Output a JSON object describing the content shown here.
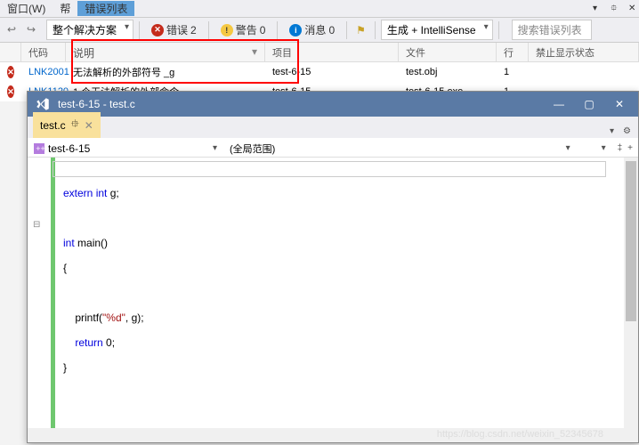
{
  "menu": {
    "window": "窗口(W)",
    "help": "帮"
  },
  "error_list_tab": "错误列表",
  "toolbar": {
    "scope": "整个解决方案",
    "errors_label": "错误",
    "errors_count": "2",
    "warnings_label": "警告",
    "warnings_count": "0",
    "messages_label": "消息",
    "messages_count": "0",
    "build_mode": "生成 + IntelliSense",
    "search_placeholder": "搜索错误列表"
  },
  "grid": {
    "headers": {
      "code": "代码",
      "desc": "说明",
      "project": "项目",
      "file": "文件",
      "line": "行",
      "suppress": "禁止显示状态"
    },
    "rows": [
      {
        "code": "LNK2001",
        "desc": "无法解析的外部符号 _g",
        "project": "test-6-15",
        "file": "test.obj",
        "line": "1"
      },
      {
        "code": "LNK1120",
        "desc": "1 个无法解析的外部命令",
        "project": "test-6-15",
        "file": "test-6-15.exe",
        "line": "1"
      }
    ]
  },
  "code_window": {
    "title": "test-6-15 - test.c",
    "tab": "test.c",
    "project_dropdown": "test-6-15",
    "scope_dropdown": "(全局范围)"
  },
  "code": {
    "l1_kw": "extern",
    "l1_type": "int",
    "l1_id": " g;",
    "l2_type": "int",
    "l2_fn": " main()",
    "l3": "{",
    "l4_fn": "printf",
    "l4_par_open": "(",
    "l4_str": "\"%d\"",
    "l4_rest": ", g);",
    "l5_kw": "return",
    "l5_rest": " 0;",
    "l6": "}"
  },
  "watermark": "https://blog.csdn.net/weixin_52345678"
}
